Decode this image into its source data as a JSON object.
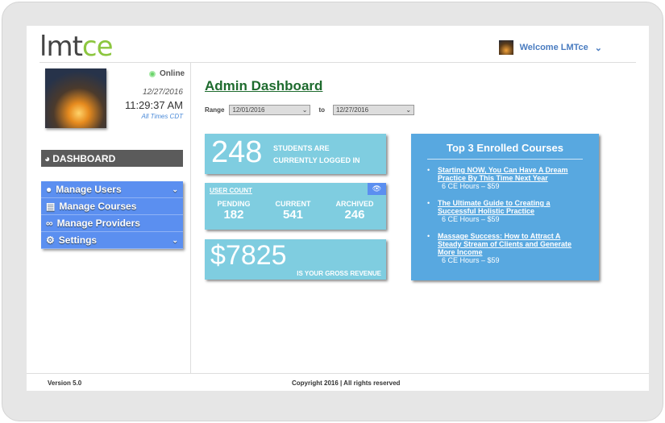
{
  "logo": {
    "part1": "lmt",
    "part2": "ce"
  },
  "header": {
    "welcome": "Welcome LMTce"
  },
  "profile": {
    "status": "Online",
    "date": "12/27/2016",
    "time": "11:29:37 AM",
    "timezone": "All Times CDT"
  },
  "sidebar": {
    "dashboard": "DASHBOARD",
    "items": [
      {
        "label": "Manage Users"
      },
      {
        "label": "Manage Courses"
      },
      {
        "label": "Manage Providers"
      },
      {
        "label": "Settings"
      }
    ]
  },
  "main": {
    "title": "Admin Dashboard",
    "range_label": "Range",
    "to_label": "to",
    "from_date": "12/01/2016",
    "to_date": "12/27/2016",
    "logged_in": {
      "value": "248",
      "text1": "STUDENTS ARE",
      "text2": "CURRENTLY LOGGED IN"
    },
    "user_count": {
      "label": "USER COUNT",
      "cols": [
        {
          "h": "PENDING",
          "v": "182"
        },
        {
          "h": "CURRENT",
          "v": "541"
        },
        {
          "h": "ARCHIVED",
          "v": "246"
        }
      ]
    },
    "revenue": {
      "value": "$7825",
      "text": "IS YOUR GROSS REVENUE"
    },
    "top3": {
      "title": "Top 3 Enrolled Courses",
      "courses": [
        {
          "name": "Starting NOW, You Can Have A Dream Practice By This Time Next Year",
          "meta": "6 CE Hours – $59"
        },
        {
          "name": "The Ultimate Guide to Creating a Successful Holistic Practice",
          "meta": "6 CE Hours – $59"
        },
        {
          "name": "Massage Success: How to Attract A Steady Stream of Clients and Generate More Income",
          "meta": "6 CE Hours – $59"
        }
      ]
    }
  },
  "footer": {
    "version": "Version 5.0",
    "copyright": "Copyright 2016 | All rights reserved"
  }
}
